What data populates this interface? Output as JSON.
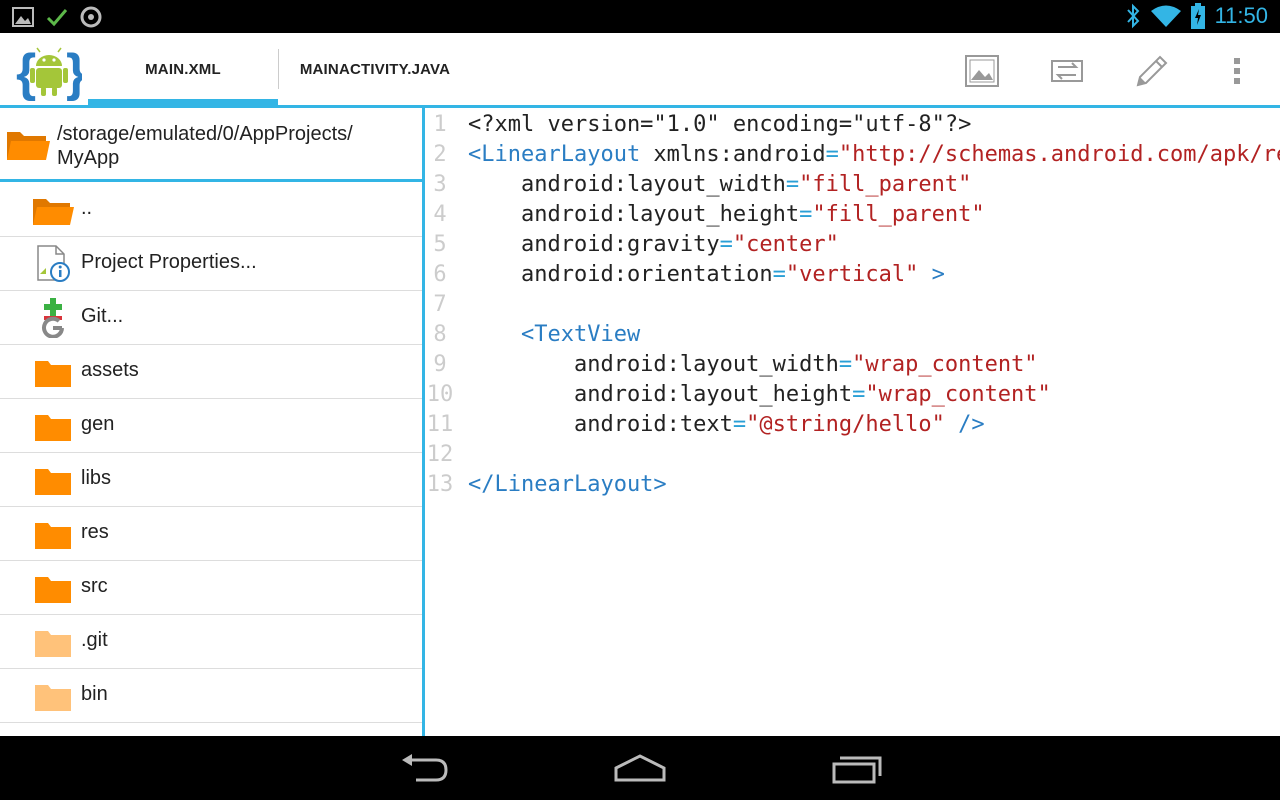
{
  "status_bar": {
    "time": "11:50",
    "left_icons": [
      "gallery-icon",
      "check-icon",
      "sync-icon"
    ],
    "right_icons": [
      "bluetooth-icon",
      "wifi-icon",
      "battery-icon"
    ]
  },
  "action_bar": {
    "tabs": [
      {
        "label": "MAIN.XML",
        "active": true
      },
      {
        "label": "MAINACTIVITY.JAVA",
        "active": false
      }
    ],
    "actions": [
      "image-preview-icon",
      "switch-icon",
      "pencil-icon",
      "overflow-menu-icon"
    ]
  },
  "file_browser": {
    "path_line1": "/storage/emulated/0/AppProjects/",
    "path_line2": "MyApp",
    "items": [
      {
        "label": "..",
        "icon": "open-folder-icon"
      },
      {
        "label": "Project Properties...",
        "icon": "project-properties-icon"
      },
      {
        "label": "Git...",
        "icon": "git-icon"
      },
      {
        "label": "assets",
        "icon": "folder-icon"
      },
      {
        "label": "gen",
        "icon": "folder-icon"
      },
      {
        "label": "libs",
        "icon": "folder-icon"
      },
      {
        "label": "res",
        "icon": "folder-icon"
      },
      {
        "label": "src",
        "icon": "folder-icon"
      },
      {
        "label": ".git",
        "icon": "light-folder-icon"
      },
      {
        "label": "bin",
        "icon": "light-folder-icon"
      }
    ]
  },
  "editor": {
    "lines": [
      {
        "num": "1",
        "tokens": [
          [
            "p",
            "<?xml version=\"1.0\" encoding=\"utf-8\"?>"
          ]
        ]
      },
      {
        "num": "2",
        "tokens": [
          [
            "t",
            "<LinearLayout"
          ],
          [
            "p",
            " xmlns:android"
          ],
          [
            "e",
            "="
          ],
          [
            "s",
            "\"http://schemas.android.com/apk/res/android\""
          ]
        ]
      },
      {
        "num": "3",
        "tokens": [
          [
            "p",
            "    android:layout_width"
          ],
          [
            "e",
            "="
          ],
          [
            "s",
            "\"fill_parent\""
          ]
        ]
      },
      {
        "num": "4",
        "tokens": [
          [
            "p",
            "    android:layout_height"
          ],
          [
            "e",
            "="
          ],
          [
            "s",
            "\"fill_parent\""
          ]
        ]
      },
      {
        "num": "5",
        "tokens": [
          [
            "p",
            "    android:gravity"
          ],
          [
            "e",
            "="
          ],
          [
            "s",
            "\"center\""
          ]
        ]
      },
      {
        "num": "6",
        "tokens": [
          [
            "p",
            "    android:orientation"
          ],
          [
            "e",
            "="
          ],
          [
            "s",
            "\"vertical\""
          ],
          [
            "t",
            " >"
          ]
        ]
      },
      {
        "num": "7",
        "tokens": []
      },
      {
        "num": "8",
        "tokens": [
          [
            "t",
            "    <TextView"
          ]
        ]
      },
      {
        "num": "9",
        "tokens": [
          [
            "p",
            "        android:layout_width"
          ],
          [
            "e",
            "="
          ],
          [
            "s",
            "\"wrap_content\""
          ]
        ]
      },
      {
        "num": "10",
        "tokens": [
          [
            "p",
            "        android:layout_height"
          ],
          [
            "e",
            "="
          ],
          [
            "s",
            "\"wrap_content\""
          ]
        ]
      },
      {
        "num": "11",
        "tokens": [
          [
            "p",
            "        android:text"
          ],
          [
            "e",
            "="
          ],
          [
            "s",
            "\"@string/hello\""
          ],
          [
            "t",
            " />"
          ]
        ]
      },
      {
        "num": "12",
        "tokens": []
      },
      {
        "num": "13",
        "tokens": [
          [
            "t",
            "</LinearLayout>"
          ]
        ]
      }
    ]
  },
  "nav_bar": {
    "buttons": [
      "back-icon",
      "home-icon",
      "recents-icon"
    ]
  },
  "colors": {
    "accent": "#33b5e5",
    "folder": "#ff8c00",
    "folder_light": "#ffc27a",
    "xml_tag": "#2a7dc3",
    "xml_string": "#b22222"
  }
}
